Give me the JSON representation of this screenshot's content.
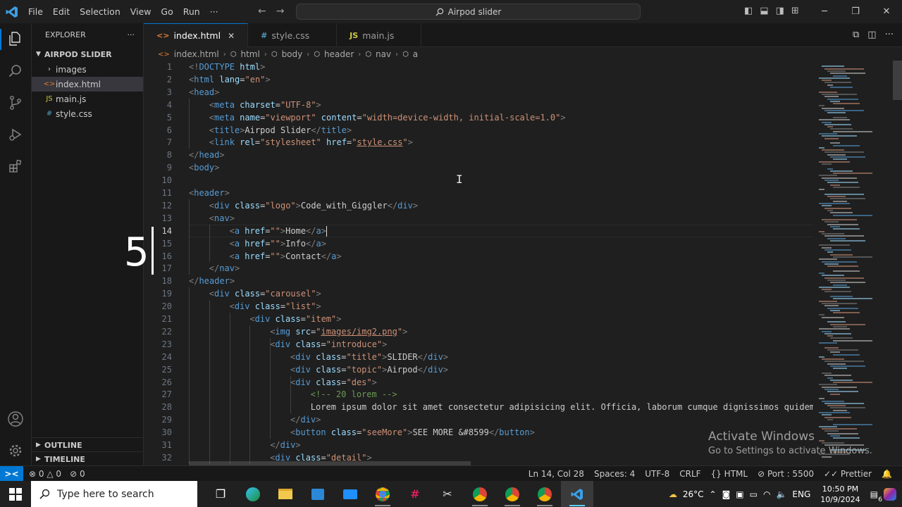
{
  "window": {
    "search": "Airpod slider",
    "menu": [
      "File",
      "Edit",
      "Selection",
      "View",
      "Go",
      "Run",
      "···"
    ]
  },
  "explorer": {
    "header": "EXPLORER",
    "more": "···",
    "root": "AIRPOD SLIDER",
    "items": [
      {
        "label": "images",
        "icon": "chevron-right-icon",
        "glyph": "›",
        "color": "#cccccc"
      },
      {
        "label": "index.html",
        "icon": "html-file-icon",
        "glyph": "<>",
        "color": "#e37933",
        "active": true
      },
      {
        "label": "main.js",
        "icon": "js-file-icon",
        "glyph": "JS",
        "color": "#cbcb41"
      },
      {
        "label": "style.css",
        "icon": "css-file-icon",
        "glyph": "#",
        "color": "#519aba"
      }
    ],
    "outline": "OUTLINE",
    "timeline": "TIMELINE"
  },
  "tabs": [
    {
      "label": "index.html",
      "glyph": "<>",
      "color": "#e37933",
      "active": true,
      "close": "✕"
    },
    {
      "label": "style.css",
      "glyph": "#",
      "color": "#519aba",
      "active": false,
      "close": ""
    },
    {
      "label": "main.js",
      "glyph": "JS",
      "color": "#cbcb41",
      "active": false,
      "close": ""
    }
  ],
  "breadcrumb": [
    "index.html",
    "html",
    "body",
    "header",
    "nav",
    "a"
  ],
  "code": {
    "current_line": 14,
    "lines": [
      {
        "n": "1",
        "indent": 0,
        "tokens": [
          [
            "b",
            "<!"
          ],
          [
            "g",
            "DOCTYPE "
          ],
          [
            "a",
            "html"
          ],
          [
            "b",
            ">"
          ]
        ]
      },
      {
        "n": "2",
        "indent": 0,
        "tokens": [
          [
            "b",
            "<"
          ],
          [
            "g",
            "html "
          ],
          [
            "a",
            "lang"
          ],
          [
            "t",
            "="
          ],
          [
            "s",
            "\"en\""
          ],
          [
            "b",
            ">"
          ]
        ]
      },
      {
        "n": "3",
        "indent": 0,
        "tokens": [
          [
            "b",
            "<"
          ],
          [
            "g",
            "head"
          ],
          [
            "b",
            ">"
          ]
        ]
      },
      {
        "n": "4",
        "indent": 1,
        "tokens": [
          [
            "b",
            "<"
          ],
          [
            "g",
            "meta "
          ],
          [
            "a",
            "charset"
          ],
          [
            "t",
            "="
          ],
          [
            "s",
            "\"UTF-8\""
          ],
          [
            "b",
            ">"
          ]
        ]
      },
      {
        "n": "5",
        "indent": 1,
        "tokens": [
          [
            "b",
            "<"
          ],
          [
            "g",
            "meta "
          ],
          [
            "a",
            "name"
          ],
          [
            "t",
            "="
          ],
          [
            "s",
            "\"viewport\""
          ],
          [
            "t",
            " "
          ],
          [
            "a",
            "content"
          ],
          [
            "t",
            "="
          ],
          [
            "s",
            "\"width=device-width, initial-scale=1.0\""
          ],
          [
            "b",
            ">"
          ]
        ]
      },
      {
        "n": "6",
        "indent": 1,
        "tokens": [
          [
            "b",
            "<"
          ],
          [
            "g",
            "title"
          ],
          [
            "b",
            ">"
          ],
          [
            "t",
            "Airpod Slider"
          ],
          [
            "b",
            "</"
          ],
          [
            "g",
            "title"
          ],
          [
            "b",
            ">"
          ]
        ]
      },
      {
        "n": "7",
        "indent": 1,
        "tokens": [
          [
            "b",
            "<"
          ],
          [
            "g",
            "link "
          ],
          [
            "a",
            "rel"
          ],
          [
            "t",
            "="
          ],
          [
            "s",
            "\"stylesheet\""
          ],
          [
            "t",
            " "
          ],
          [
            "a",
            "href"
          ],
          [
            "t",
            "="
          ],
          [
            "s",
            "\""
          ],
          [
            "u",
            "style.css"
          ],
          [
            "s",
            "\""
          ],
          [
            "b",
            ">"
          ]
        ]
      },
      {
        "n": "8",
        "indent": 0,
        "tokens": [
          [
            "b",
            "</"
          ],
          [
            "g",
            "head"
          ],
          [
            "b",
            ">"
          ]
        ]
      },
      {
        "n": "9",
        "indent": 0,
        "tokens": [
          [
            "b",
            "<"
          ],
          [
            "g",
            "body"
          ],
          [
            "b",
            ">"
          ]
        ]
      },
      {
        "n": "10",
        "indent": 0,
        "tokens": []
      },
      {
        "n": "11",
        "indent": 0,
        "tokens": [
          [
            "b",
            "<"
          ],
          [
            "g",
            "header"
          ],
          [
            "b",
            ">"
          ]
        ]
      },
      {
        "n": "12",
        "indent": 1,
        "tokens": [
          [
            "b",
            "<"
          ],
          [
            "g",
            "div "
          ],
          [
            "a",
            "class"
          ],
          [
            "t",
            "="
          ],
          [
            "s",
            "\"logo\""
          ],
          [
            "b",
            ">"
          ],
          [
            "t",
            "Code_with_Giggler"
          ],
          [
            "b",
            "</"
          ],
          [
            "g",
            "div"
          ],
          [
            "b",
            ">"
          ]
        ]
      },
      {
        "n": "13",
        "indent": 1,
        "tokens": [
          [
            "b",
            "<"
          ],
          [
            "g",
            "nav"
          ],
          [
            "b",
            ">"
          ]
        ]
      },
      {
        "n": "14",
        "indent": 2,
        "cursor": true,
        "tokens": [
          [
            "b",
            "<"
          ],
          [
            "g",
            "a "
          ],
          [
            "a",
            "href"
          ],
          [
            "t",
            "="
          ],
          [
            "s",
            "\"\""
          ],
          [
            "b",
            ">"
          ],
          [
            "t",
            "Home"
          ],
          [
            "b",
            "</"
          ],
          [
            "g",
            "a"
          ],
          [
            "b",
            ">"
          ]
        ]
      },
      {
        "n": "15",
        "indent": 2,
        "tokens": [
          [
            "b",
            "<"
          ],
          [
            "g",
            "a "
          ],
          [
            "a",
            "href"
          ],
          [
            "t",
            "="
          ],
          [
            "s",
            "\"\""
          ],
          [
            "b",
            ">"
          ],
          [
            "t",
            "Info"
          ],
          [
            "b",
            "</"
          ],
          [
            "g",
            "a"
          ],
          [
            "b",
            ">"
          ]
        ]
      },
      {
        "n": "16",
        "indent": 2,
        "tokens": [
          [
            "b",
            "<"
          ],
          [
            "g",
            "a "
          ],
          [
            "a",
            "href"
          ],
          [
            "t",
            "="
          ],
          [
            "s",
            "\"\""
          ],
          [
            "b",
            ">"
          ],
          [
            "t",
            "Contact"
          ],
          [
            "b",
            "</"
          ],
          [
            "g",
            "a"
          ],
          [
            "b",
            ">"
          ]
        ]
      },
      {
        "n": "17",
        "indent": 1,
        "tokens": [
          [
            "b",
            "</"
          ],
          [
            "g",
            "nav"
          ],
          [
            "b",
            ">"
          ]
        ]
      },
      {
        "n": "18",
        "indent": 0,
        "tokens": [
          [
            "b",
            "</"
          ],
          [
            "g",
            "header"
          ],
          [
            "b",
            ">"
          ]
        ]
      },
      {
        "n": "19",
        "indent": 1,
        "tokens": [
          [
            "b",
            "<"
          ],
          [
            "g",
            "div "
          ],
          [
            "a",
            "class"
          ],
          [
            "t",
            "="
          ],
          [
            "s",
            "\"carousel\""
          ],
          [
            "b",
            ">"
          ]
        ]
      },
      {
        "n": "20",
        "indent": 2,
        "tokens": [
          [
            "b",
            "<"
          ],
          [
            "g",
            "div "
          ],
          [
            "a",
            "class"
          ],
          [
            "t",
            "="
          ],
          [
            "s",
            "\"list\""
          ],
          [
            "b",
            ">"
          ]
        ]
      },
      {
        "n": "21",
        "indent": 3,
        "tokens": [
          [
            "b",
            "<"
          ],
          [
            "g",
            "div "
          ],
          [
            "a",
            "class"
          ],
          [
            "t",
            "="
          ],
          [
            "s",
            "\"item\""
          ],
          [
            "b",
            ">"
          ]
        ]
      },
      {
        "n": "22",
        "indent": 4,
        "tokens": [
          [
            "b",
            "<"
          ],
          [
            "g",
            "img "
          ],
          [
            "a",
            "src"
          ],
          [
            "t",
            "="
          ],
          [
            "s",
            "\""
          ],
          [
            "u",
            "images/img2.png"
          ],
          [
            "s",
            "\""
          ],
          [
            "b",
            ">"
          ]
        ]
      },
      {
        "n": "23",
        "indent": 4,
        "tokens": [
          [
            "b",
            "<"
          ],
          [
            "g",
            "div "
          ],
          [
            "a",
            "class"
          ],
          [
            "t",
            "="
          ],
          [
            "s",
            "\"introduce\""
          ],
          [
            "b",
            ">"
          ]
        ]
      },
      {
        "n": "24",
        "indent": 5,
        "tokens": [
          [
            "b",
            "<"
          ],
          [
            "g",
            "div "
          ],
          [
            "a",
            "class"
          ],
          [
            "t",
            "="
          ],
          [
            "s",
            "\"title\""
          ],
          [
            "b",
            ">"
          ],
          [
            "t",
            "SLIDER"
          ],
          [
            "b",
            "</"
          ],
          [
            "g",
            "div"
          ],
          [
            "b",
            ">"
          ]
        ]
      },
      {
        "n": "25",
        "indent": 5,
        "tokens": [
          [
            "b",
            "<"
          ],
          [
            "g",
            "div "
          ],
          [
            "a",
            "class"
          ],
          [
            "t",
            "="
          ],
          [
            "s",
            "\"topic\""
          ],
          [
            "b",
            ">"
          ],
          [
            "t",
            "Airpod"
          ],
          [
            "b",
            "</"
          ],
          [
            "g",
            "div"
          ],
          [
            "b",
            ">"
          ]
        ]
      },
      {
        "n": "26",
        "indent": 5,
        "tokens": [
          [
            "b",
            "<"
          ],
          [
            "g",
            "div "
          ],
          [
            "a",
            "class"
          ],
          [
            "t",
            "="
          ],
          [
            "s",
            "\"des\""
          ],
          [
            "b",
            ">"
          ]
        ]
      },
      {
        "n": "27",
        "indent": 6,
        "tokens": [
          [
            "c",
            "<!-- 20 lorem -->"
          ]
        ]
      },
      {
        "n": "28",
        "indent": 6,
        "tokens": [
          [
            "t",
            "Lorem ipsum dolor sit amet consectetur adipisicing elit. Officia, laborum cumque dignissimos quidem"
          ]
        ]
      },
      {
        "n": "29",
        "indent": 5,
        "tokens": [
          [
            "b",
            "</"
          ],
          [
            "g",
            "div"
          ],
          [
            "b",
            ">"
          ]
        ]
      },
      {
        "n": "30",
        "indent": 5,
        "tokens": [
          [
            "b",
            "<"
          ],
          [
            "g",
            "button "
          ],
          [
            "a",
            "class"
          ],
          [
            "t",
            "="
          ],
          [
            "s",
            "\"seeMore\""
          ],
          [
            "b",
            ">"
          ],
          [
            "t",
            "SEE MORE &#8599"
          ],
          [
            "b",
            "</"
          ],
          [
            "g",
            "button"
          ],
          [
            "b",
            ">"
          ]
        ]
      },
      {
        "n": "31",
        "indent": 4,
        "tokens": [
          [
            "b",
            "</"
          ],
          [
            "g",
            "div"
          ],
          [
            "b",
            ">"
          ]
        ]
      },
      {
        "n": "32",
        "indent": 4,
        "tokens": [
          [
            "b",
            "<"
          ],
          [
            "g",
            "div "
          ],
          [
            "a",
            "class"
          ],
          [
            "t",
            "="
          ],
          [
            "s",
            "\"detail\""
          ],
          [
            "b",
            ">"
          ]
        ]
      }
    ]
  },
  "overlay_number": "5",
  "watermark": {
    "title": "Activate Windows",
    "subtitle": "Go to Settings to activate Windows."
  },
  "status": {
    "errors": "0",
    "warnings": "0",
    "ports_count": "0",
    "position": "Ln 14, Col 28",
    "spaces": "Spaces: 4",
    "encoding": "UTF-8",
    "eol": "CRLF",
    "language": "HTML",
    "port": "Port : 5500",
    "formatter": "Prettier"
  },
  "taskbar": {
    "search_placeholder": "Type here to search",
    "temperature": "26°C",
    "language": "ENG",
    "time": "10:50 PM",
    "date": "10/9/2024",
    "notifications": "6"
  },
  "colors": {
    "accent": "#0078d4",
    "tag": "#569cd6",
    "attribute": "#9cdcfe",
    "string": "#ce9178",
    "comment": "#6a9955"
  }
}
